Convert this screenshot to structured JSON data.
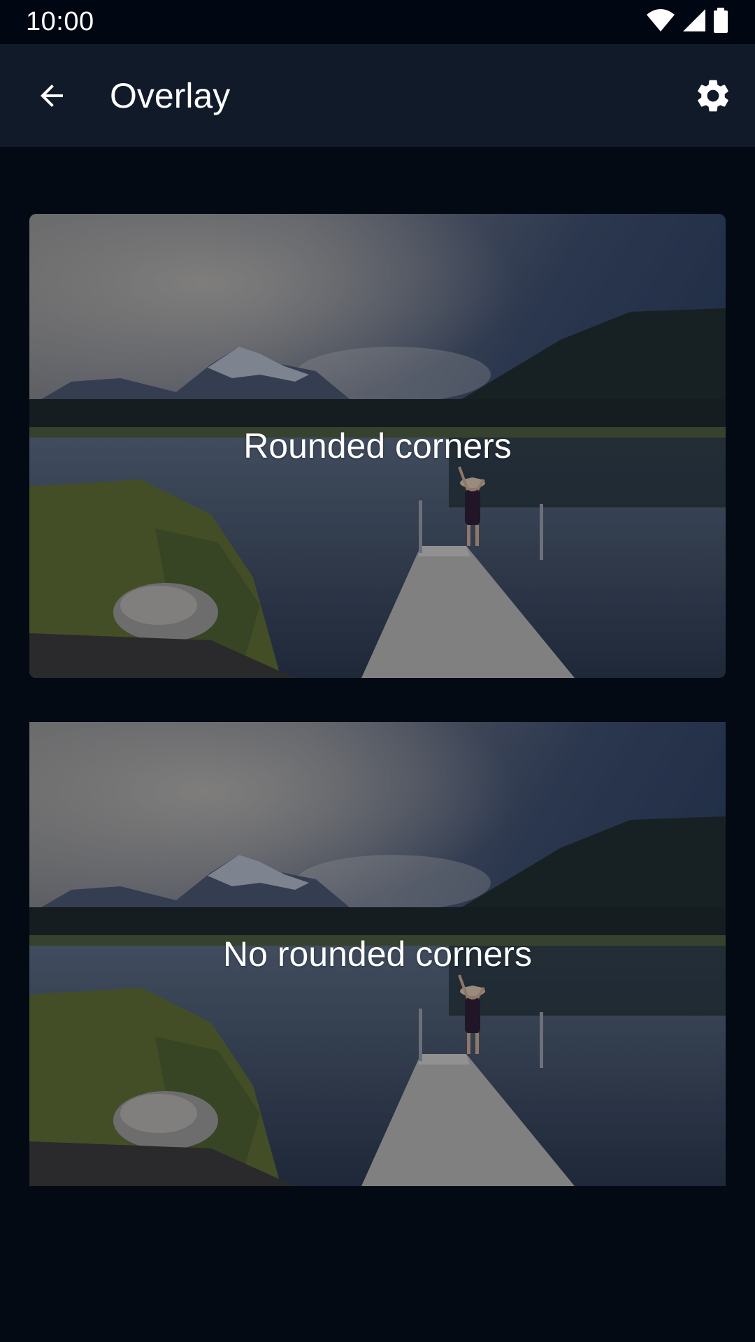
{
  "status_bar": {
    "time": "10:00",
    "icons": [
      "wifi-icon",
      "cellular-signal-icon",
      "battery-icon"
    ]
  },
  "app_bar": {
    "title": "Overlay",
    "back_icon": "arrow-back-icon",
    "settings_icon": "gear-icon"
  },
  "cards": [
    {
      "label": "Rounded corners",
      "rounded": true
    },
    {
      "label": "No rounded corners",
      "rounded": false
    }
  ],
  "colors": {
    "background": "#030a14",
    "status_bar": "#010712",
    "app_bar": "#111a28",
    "text": "#ffffff"
  }
}
